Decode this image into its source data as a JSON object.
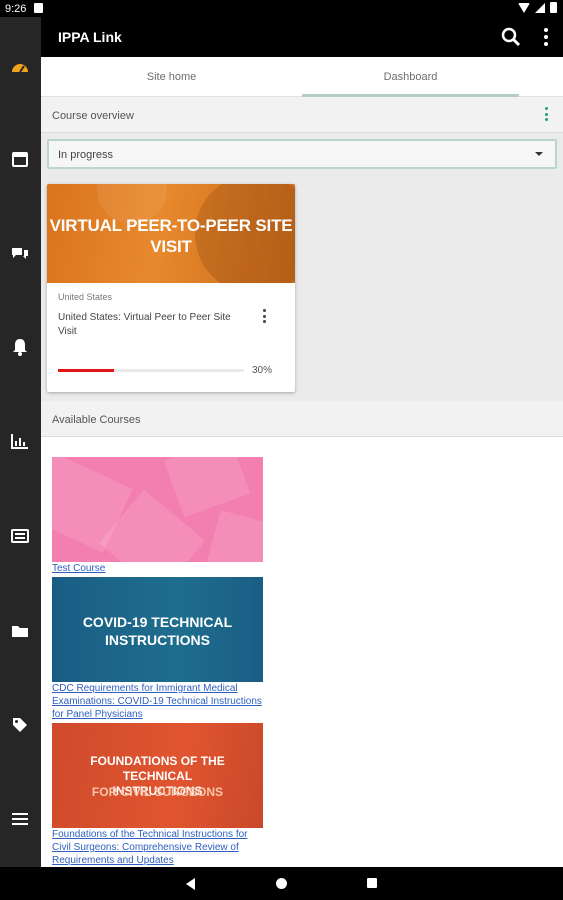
{
  "status_bar": {
    "time": "9:26"
  },
  "app_bar": {
    "title": "IPPA Link"
  },
  "tabs": [
    {
      "label": "Site home"
    },
    {
      "label": "Dashboard"
    }
  ],
  "course_overview": {
    "label": "Course overview",
    "filter": "In progress",
    "card": {
      "banner_title": "VIRTUAL PEER-TO-PEER SITE VISIT",
      "category": "United States",
      "name": "United States: Virtual Peer to Peer Site Visit",
      "progress": 30,
      "progress_label": "30%"
    }
  },
  "available_courses": {
    "label": "Available Courses",
    "items": [
      {
        "link": "Test Course"
      },
      {
        "image_title": "COVID-19 TECHNICAL INSTRUCTIONS",
        "link": "CDC Requirements for Immigrant Medical Examinations: COVID-19 Technical Instructions for Panel Physicians"
      },
      {
        "image_title": "FOUNDATIONS OF THE TECHNICAL INSTRUCTIONS",
        "image_subtitle": "FOR CIVIL SURGEONS",
        "link": "Foundations of the Technical Instructions for Civil Surgeons: Comprehensive Review of Requirements and Updates"
      }
    ]
  },
  "colors": {
    "accent": "#2a9d7f",
    "progress": "#e3151b",
    "link": "#2f5fbf",
    "rail": "#262626"
  }
}
